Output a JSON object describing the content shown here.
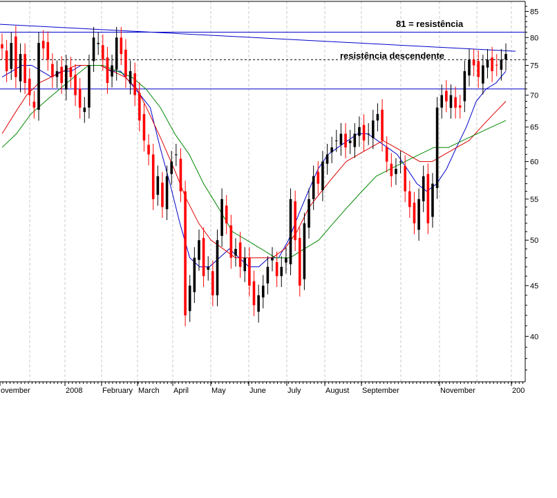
{
  "chart_data": {
    "type": "candlestick",
    "annotations": [
      "81 = resistência",
      "resistência descendente"
    ],
    "y_axis": {
      "ticks": [
        40,
        45,
        50,
        55,
        60,
        65,
        70,
        75,
        80,
        85
      ],
      "range": [
        36,
        87
      ],
      "scale": "log",
      "side": "right"
    },
    "x_axis": {
      "labels": [
        "ovember",
        "2008",
        "February",
        "March",
        "April",
        "May",
        "June",
        "July",
        "August",
        "September",
        "November",
        "200"
      ]
    },
    "horizontal_lines": [
      {
        "value": 81,
        "style": "solid",
        "color": "#0000cc"
      },
      {
        "value": 71,
        "style": "solid",
        "color": "#0000cc"
      },
      {
        "value": 76,
        "style": "dashed",
        "color": "#000000"
      }
    ],
    "trendline": {
      "from": 82.5,
      "to": 77.5,
      "color": "#0000cc"
    },
    "grid": "vertical dashed",
    "colors": {
      "up": "#000000",
      "down": "#ff0000",
      "ma_short": "#0000cc",
      "ma_mid": "#dd0000",
      "ma_long": "#008800"
    },
    "series": [
      {
        "type": "close",
        "values": [
          78,
          74,
          79,
          73,
          77,
          72,
          70,
          68,
          79,
          78,
          76,
          73,
          74,
          72,
          75,
          73,
          70,
          68,
          68,
          75,
          80,
          79,
          76,
          72,
          75,
          80,
          77,
          73,
          74,
          70,
          66,
          63,
          61,
          55,
          58,
          54,
          58,
          60,
          61,
          56,
          42,
          45,
          48,
          50,
          46,
          47,
          44,
          50,
          55,
          52,
          48,
          49,
          47,
          48,
          45,
          43,
          44,
          45,
          47,
          48,
          46,
          47,
          48,
          55,
          50,
          45,
          52,
          55,
          58,
          57,
          60,
          61,
          62,
          63,
          64,
          62,
          63,
          64,
          65,
          63,
          64,
          66,
          67,
          63,
          60,
          58,
          59,
          60,
          56,
          54,
          52,
          55,
          58,
          52,
          57,
          68,
          70,
          69,
          70,
          68,
          68,
          74,
          76,
          75,
          73,
          75,
          76,
          74,
          75,
          76,
          77
        ]
      },
      {
        "type": "moving_average",
        "values": [
          73,
          74,
          75,
          75,
          74,
          73,
          74,
          74,
          75,
          75,
          75,
          74,
          74,
          72,
          70,
          68,
          62,
          57,
          52,
          48,
          47,
          47,
          48,
          49,
          48,
          47,
          47,
          48,
          48,
          50,
          53,
          56,
          59,
          61,
          62,
          63,
          64,
          64,
          63,
          62,
          61,
          59,
          57,
          56,
          57,
          59,
          62,
          65,
          69,
          71,
          72,
          74
        ]
      },
      {
        "type": "moving_average",
        "values": [
          64,
          67,
          70,
          72,
          73,
          74,
          75,
          75,
          75,
          74,
          73,
          71,
          67,
          63,
          59,
          55,
          52,
          50,
          49,
          48,
          48,
          48,
          48,
          49,
          51,
          54,
          56,
          58,
          60,
          61,
          62,
          63,
          62,
          61,
          60,
          60,
          61,
          62,
          63,
          65,
          67,
          69
        ]
      },
      {
        "type": "moving_average",
        "values": [
          62,
          64,
          67,
          69,
          71,
          73,
          75,
          75,
          74,
          73,
          71,
          68,
          64,
          61,
          57,
          54,
          51,
          50,
          49,
          48,
          48,
          49,
          50,
          52,
          54,
          56,
          58,
          59,
          60,
          61,
          62,
          62,
          63,
          64,
          65,
          66
        ]
      }
    ]
  }
}
